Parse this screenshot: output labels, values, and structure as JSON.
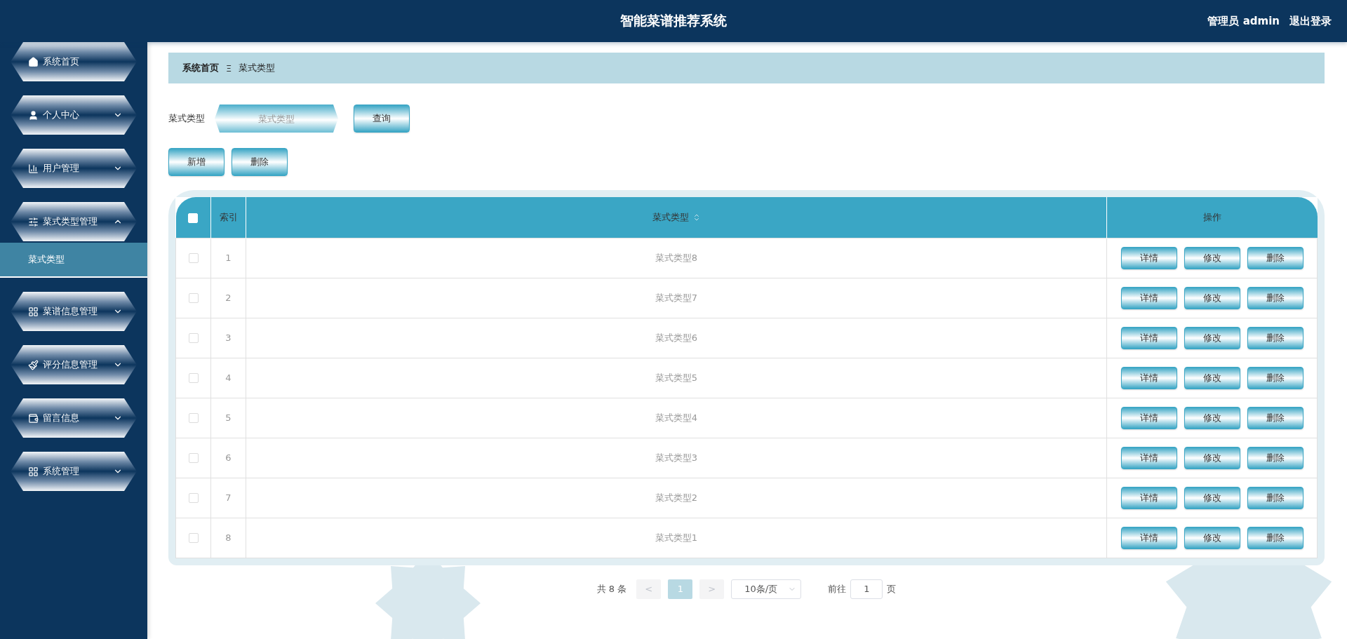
{
  "header": {
    "title": "智能菜谱推荐系统",
    "user": "管理员 admin",
    "logout": "退出登录"
  },
  "sidebar": {
    "items": [
      {
        "label": "系统首页",
        "kind": "link"
      },
      {
        "label": "个人中心",
        "kind": "menu",
        "expanded": false
      },
      {
        "label": "用户管理",
        "kind": "menu",
        "expanded": false
      },
      {
        "label": "菜式类型管理",
        "kind": "menu",
        "expanded": true,
        "children": [
          {
            "label": "菜式类型",
            "selected": true
          }
        ]
      },
      {
        "label": "菜谱信息管理",
        "kind": "menu",
        "expanded": false
      },
      {
        "label": "评分信息管理",
        "kind": "menu",
        "expanded": false
      },
      {
        "label": "留言信息",
        "kind": "menu",
        "expanded": false
      },
      {
        "label": "系统管理",
        "kind": "menu",
        "expanded": false
      }
    ]
  },
  "breadcrumb": {
    "items": [
      "系统首页",
      "菜式类型"
    ],
    "separator": "Ξ"
  },
  "search": {
    "label": "菜式类型",
    "placeholder": "菜式类型",
    "button": "查询"
  },
  "actions": [
    "新增",
    "删除"
  ],
  "table": {
    "select_all": {
      "checked": false
    },
    "columns": [
      {
        "label": "索引"
      },
      {
        "label": "菜式类型",
        "sortable": true
      },
      {
        "label": "操作"
      }
    ],
    "rows": [
      {
        "index": "1",
        "type": "菜式类型8",
        "checked": false,
        "actions": [
          "详情",
          "修改",
          "删除"
        ]
      },
      {
        "index": "2",
        "type": "菜式类型7",
        "checked": false,
        "actions": [
          "详情",
          "修改",
          "删除"
        ]
      },
      {
        "index": "3",
        "type": "菜式类型6",
        "checked": false,
        "actions": [
          "详情",
          "修改",
          "删除"
        ]
      },
      {
        "index": "4",
        "type": "菜式类型5",
        "checked": false,
        "actions": [
          "详情",
          "修改",
          "删除"
        ]
      },
      {
        "index": "5",
        "type": "菜式类型4",
        "checked": false,
        "actions": [
          "详情",
          "修改",
          "删除"
        ]
      },
      {
        "index": "6",
        "type": "菜式类型3",
        "checked": false,
        "actions": [
          "详情",
          "修改",
          "删除"
        ]
      },
      {
        "index": "7",
        "type": "菜式类型2",
        "checked": false,
        "actions": [
          "详情",
          "修改",
          "删除"
        ]
      },
      {
        "index": "8",
        "type": "菜式类型1",
        "checked": false,
        "actions": [
          "详情",
          "修改",
          "删除"
        ]
      }
    ]
  },
  "pagination": {
    "total": "共 8 条",
    "prev": "<",
    "pages": [
      {
        "label": "1",
        "selected": true
      }
    ],
    "next": ">",
    "page_size": "10条/页",
    "goto_label": "前往",
    "goto_value": "1",
    "goto_suffix": "页"
  }
}
